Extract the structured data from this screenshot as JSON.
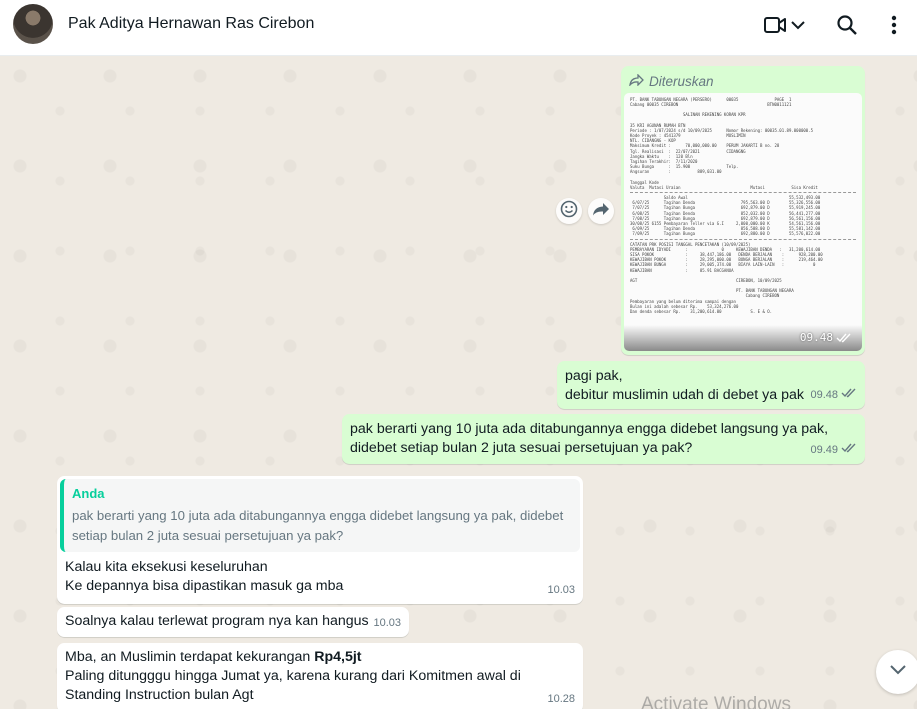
{
  "header": {
    "contact_name": "Pak Aditya Hernawan Ras Cirebon",
    "icons": [
      "video-call-icon",
      "chevron-down-icon",
      "search-icon",
      "menu-icon"
    ]
  },
  "messages": {
    "forwarded_image": {
      "forwarded_label": "Diteruskan",
      "time": "09.48",
      "doc_lines": [
        "PT. BANK TABUNGAN NEGARA (PERSERO)      00035               PAGE  1",
        "Cabang 00035 CIREBON                                     BTN0011121",
        "",
        "                      SALINAN REKENING KORAN KPR",
        "",
        "35 KRI AGUNAN RUMAH BTN",
        "Periode : 1/07/2024 s/d 10/09/2025      Nomor Rekening: 00035.01.89.000000.5",
        "Kode Proyek : 4541379                   MUSLIMIN",
        "NTL. CIDANGNG - KOP",
        "Maksimum Kredit :      70,000,000.00    PERUM JAKARTI B no. 28",
        "Tgl. Realisasi  :  22/07/2021           CIDANGNG",
        "Jangka Waktu    :  120 Bln",
        "Tagihan Terakhir:  7/11/2020",
        "Suku Bunga      :  15.900               Telp.",
        "Angsuran        :           889,031.00",
        "",
        "Tanggal Kode",
        "Valuta  Mutasi Uraian                             Mutasi           Sisa Kredit"
      ],
      "doc_rows": [
        "              Saldo Awal                                          55,532,493.00",
        " 6/07/25      Tagihan Denda                   795,563.00 D        55,326,556.00",
        " 7/07/25      Tagihan Bunga                   692,879.00 D        55,919,245.00",
        " 6/08/25      Tagihan Denda                   852,032.00 D        56,441,277.00",
        " 7/08/25      Tagihan Bunga                   692,879.00 D        56,561,156.00",
        "30/08/25 6155 Pembayaran Teller via G.I     2,000,000.00 K        54,561,156.00",
        " 6/09/25      Tagihan Denda                   856,588.00 D        55,581,142.00",
        " 7/09/25      Tagihan Bunga                   692,880.00 D        55,576,022.00"
      ],
      "doc_footer": [
        "CATATAN PRK POSISI TANGGAL PENCETAKAN (10/09/2025)",
        "PEMBAYARAN IDYADI      :              0     KEWAJIBAN DENDA   :   31,200,614.00",
        "SISA POKOK             :     38,447,186.00   DENDA BERJALAN    :      928,200.00",
        "KEWAJIBAN POKOK        :     28,295,000.00   BUNGA BERJALAN    :      219,464.00",
        "KEWAJIBAN BUNGA        :     29,005,374.00   BIAYA LAIN-LAIN   :            0",
        "KEWAJIBAN              :     85.91 BACGANUA",
        "",
        "AGT                                         CIREBON, 10/09/2025",
        "",
        "                                            PT. BANK TABUNGAN NEGARA",
        "                                                Cabang CIREBON",
        "Pembayaran yang belum diterima sampai dengan",
        "Bulan ini adalah sebesar Rp.    53,324,276.00",
        "Dan denda sebesar Rp.    31,200,614.00            S. E & O."
      ]
    },
    "msg1": {
      "line1": "pagi pak,",
      "line2": "debitur muslimin udah di debet ya pak",
      "time": "09.48"
    },
    "msg2": {
      "line1": "pak berarti yang 10 juta ada ditabungannya engga didebet langsung ya pak,",
      "line2": "didebet setiap bulan 2 juta sesuai persetujuan ya pak?",
      "time": "09.49"
    },
    "msg3": {
      "quote_author": "Anda",
      "quote_line1": "pak berarti yang 10 juta ada ditabungannya engga didebet langsung ya pak, didebet",
      "quote_line2": "setiap bulan 2 juta sesuai persetujuan ya pak?",
      "line1": "Kalau kita eksekusi keseluruhan",
      "line2": "Ke depannya bisa dipastikan masuk ga mba",
      "time": "10.03"
    },
    "msg4": {
      "text": "Soalnya kalau terlewat program nya kan hangus",
      "time": "10.03"
    },
    "msg5": {
      "line1_prefix": "Mba, an Muslimin terdapat kekurangan ",
      "line1_bold": "Rp4,5jt",
      "line2": "Paling ditungggu hingga Jumat ya, karena kurang dari Komitmen awal di",
      "line3": "Standing Instruction bulan Agt",
      "time": "10.28"
    }
  },
  "watermark": "Activate Windows",
  "colors": {
    "outgoing_bubble": "#d9fdd3",
    "incoming_bubble": "#ffffff",
    "quote_accent": "#06cf9c",
    "read_ticks": "#667781",
    "chat_background": "#efeae2"
  }
}
